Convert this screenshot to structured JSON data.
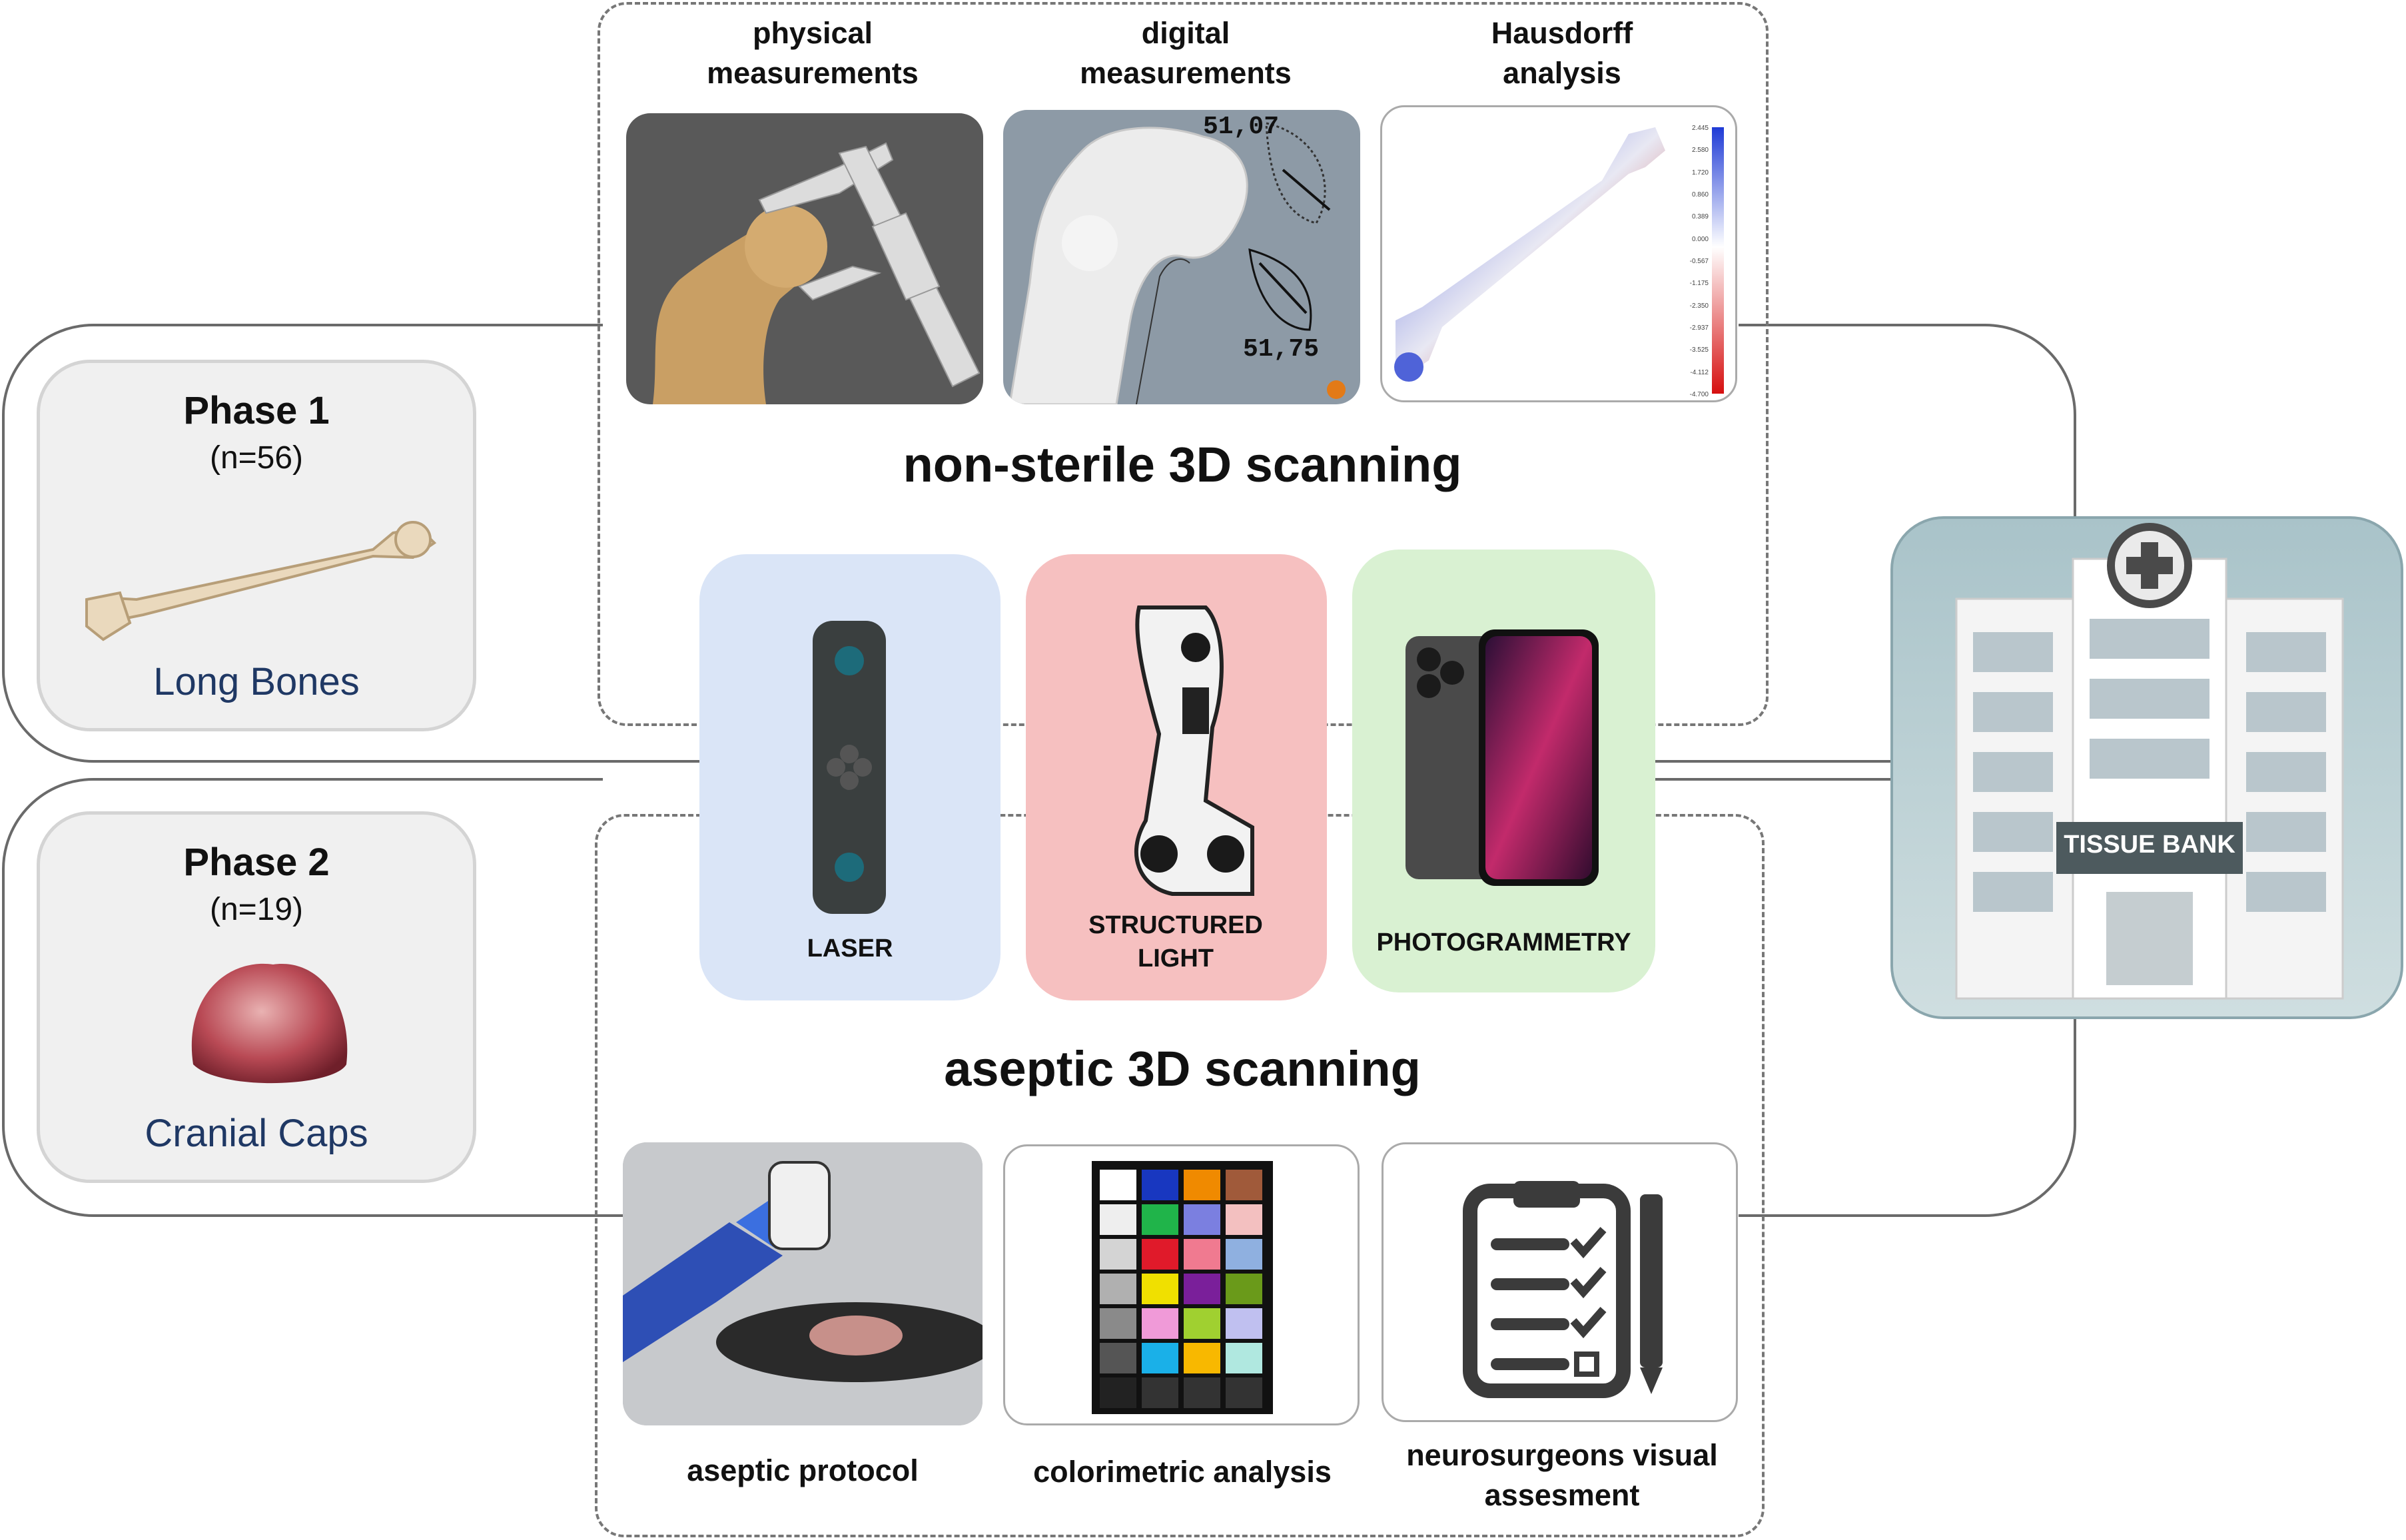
{
  "phases": [
    {
      "title": "Phase 1",
      "n": "(n=56)",
      "label": "Long Bones"
    },
    {
      "title": "Phase 2",
      "n": "(n=19)",
      "label": "Cranial Caps"
    }
  ],
  "non_sterile": {
    "title": "non-sterile 3D scanning",
    "captions": {
      "physical": "physical measurements",
      "digital": "digital measurements",
      "hausdorff": "Hausdorff analysis"
    },
    "digital_values": {
      "top": "51,07",
      "bottom": "51,75"
    },
    "hausdorff_scale": [
      "2.445",
      "2.580",
      "1.720",
      "0.860",
      "0.389",
      "0.000",
      "-0.567",
      "-1.175",
      "-2.350",
      "-2.937",
      "-3.525",
      "-4.112",
      "-4.700"
    ]
  },
  "scanners": [
    {
      "label": "LASER",
      "color": "#dae5f7"
    },
    {
      "label": "STRUCTURED LIGHT",
      "color": "#f6c0c0"
    },
    {
      "label": "PHOTOGRAMMETRY",
      "color": "#d9f1d2"
    }
  ],
  "aseptic": {
    "title": "aseptic 3D scanning",
    "captions": {
      "protocol": "aseptic protocol",
      "colorimetric": "colorimetric analysis",
      "neuro": "neurosurgeons visual assesment"
    }
  },
  "tissue_bank": {
    "sign": "TISSUE BANK"
  },
  "colors": {
    "border": "#777777",
    "phase_card": "#f0f0f0",
    "phase_label": "#1f3864"
  }
}
